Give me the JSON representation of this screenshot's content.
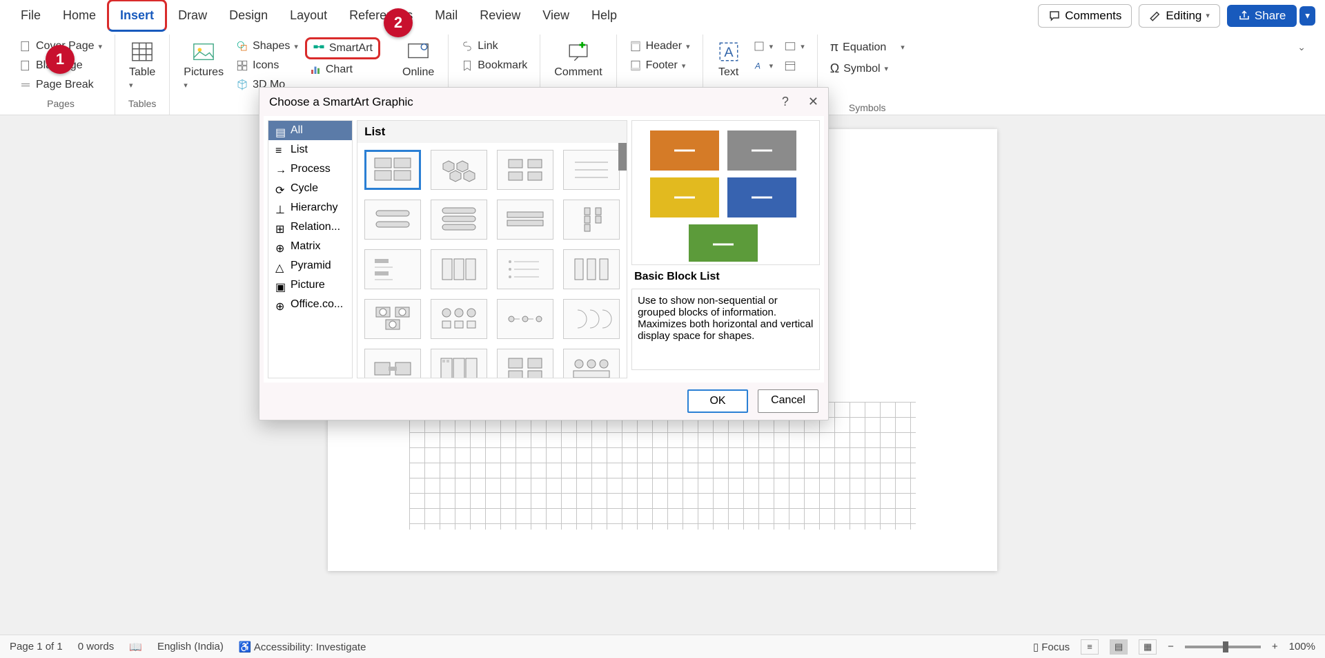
{
  "tabs": {
    "file": "File",
    "home": "Home",
    "insert": "Insert",
    "draw": "Draw",
    "design": "Design",
    "layout": "Layout",
    "references": "References",
    "mailings": "Mail",
    "review": "Review",
    "view": "View",
    "help": "Help"
  },
  "top_right": {
    "comments": "Comments",
    "editing": "Editing",
    "share": "Share"
  },
  "ribbon": {
    "pages": {
      "cover": "Cover Page",
      "blank": "Blank Page",
      "break": "Page Break",
      "label": "Pages"
    },
    "tables": {
      "table": "Table",
      "label": "Tables"
    },
    "illustrations": {
      "pictures": "Pictures",
      "shapes": "Shapes",
      "icons": "Icons",
      "models3d": "3D Mo",
      "smartart": "SmartArt",
      "chart": "Chart"
    },
    "online": "Online",
    "links": {
      "link": "Link",
      "bookmark": "Bookmark"
    },
    "comment": {
      "btn": "Comment"
    },
    "header_footer": {
      "header": "Header",
      "footer": "Footer"
    },
    "text": {
      "label": "Text"
    },
    "symbols": {
      "equation": "Equation",
      "symbol": "Symbol",
      "label": "Symbols"
    }
  },
  "badges": {
    "one": "1",
    "two": "2"
  },
  "dialog": {
    "title": "Choose a SmartArt Graphic",
    "help": "?",
    "categories": [
      "All",
      "List",
      "Process",
      "Cycle",
      "Hierarchy",
      "Relation...",
      "Matrix",
      "Pyramid",
      "Picture",
      "Office.co..."
    ],
    "gallery_header": "List",
    "preview_title": "Basic Block List",
    "preview_desc": "Use to show non-sequential or grouped blocks of information. Maximizes both horizontal and vertical display space for shapes.",
    "ok": "OK",
    "cancel": "Cancel"
  },
  "status": {
    "page": "Page 1 of 1",
    "words": "0 words",
    "lang": "English (India)",
    "acc": "Accessibility: Investigate",
    "focus": "Focus",
    "zoom": "100%"
  }
}
